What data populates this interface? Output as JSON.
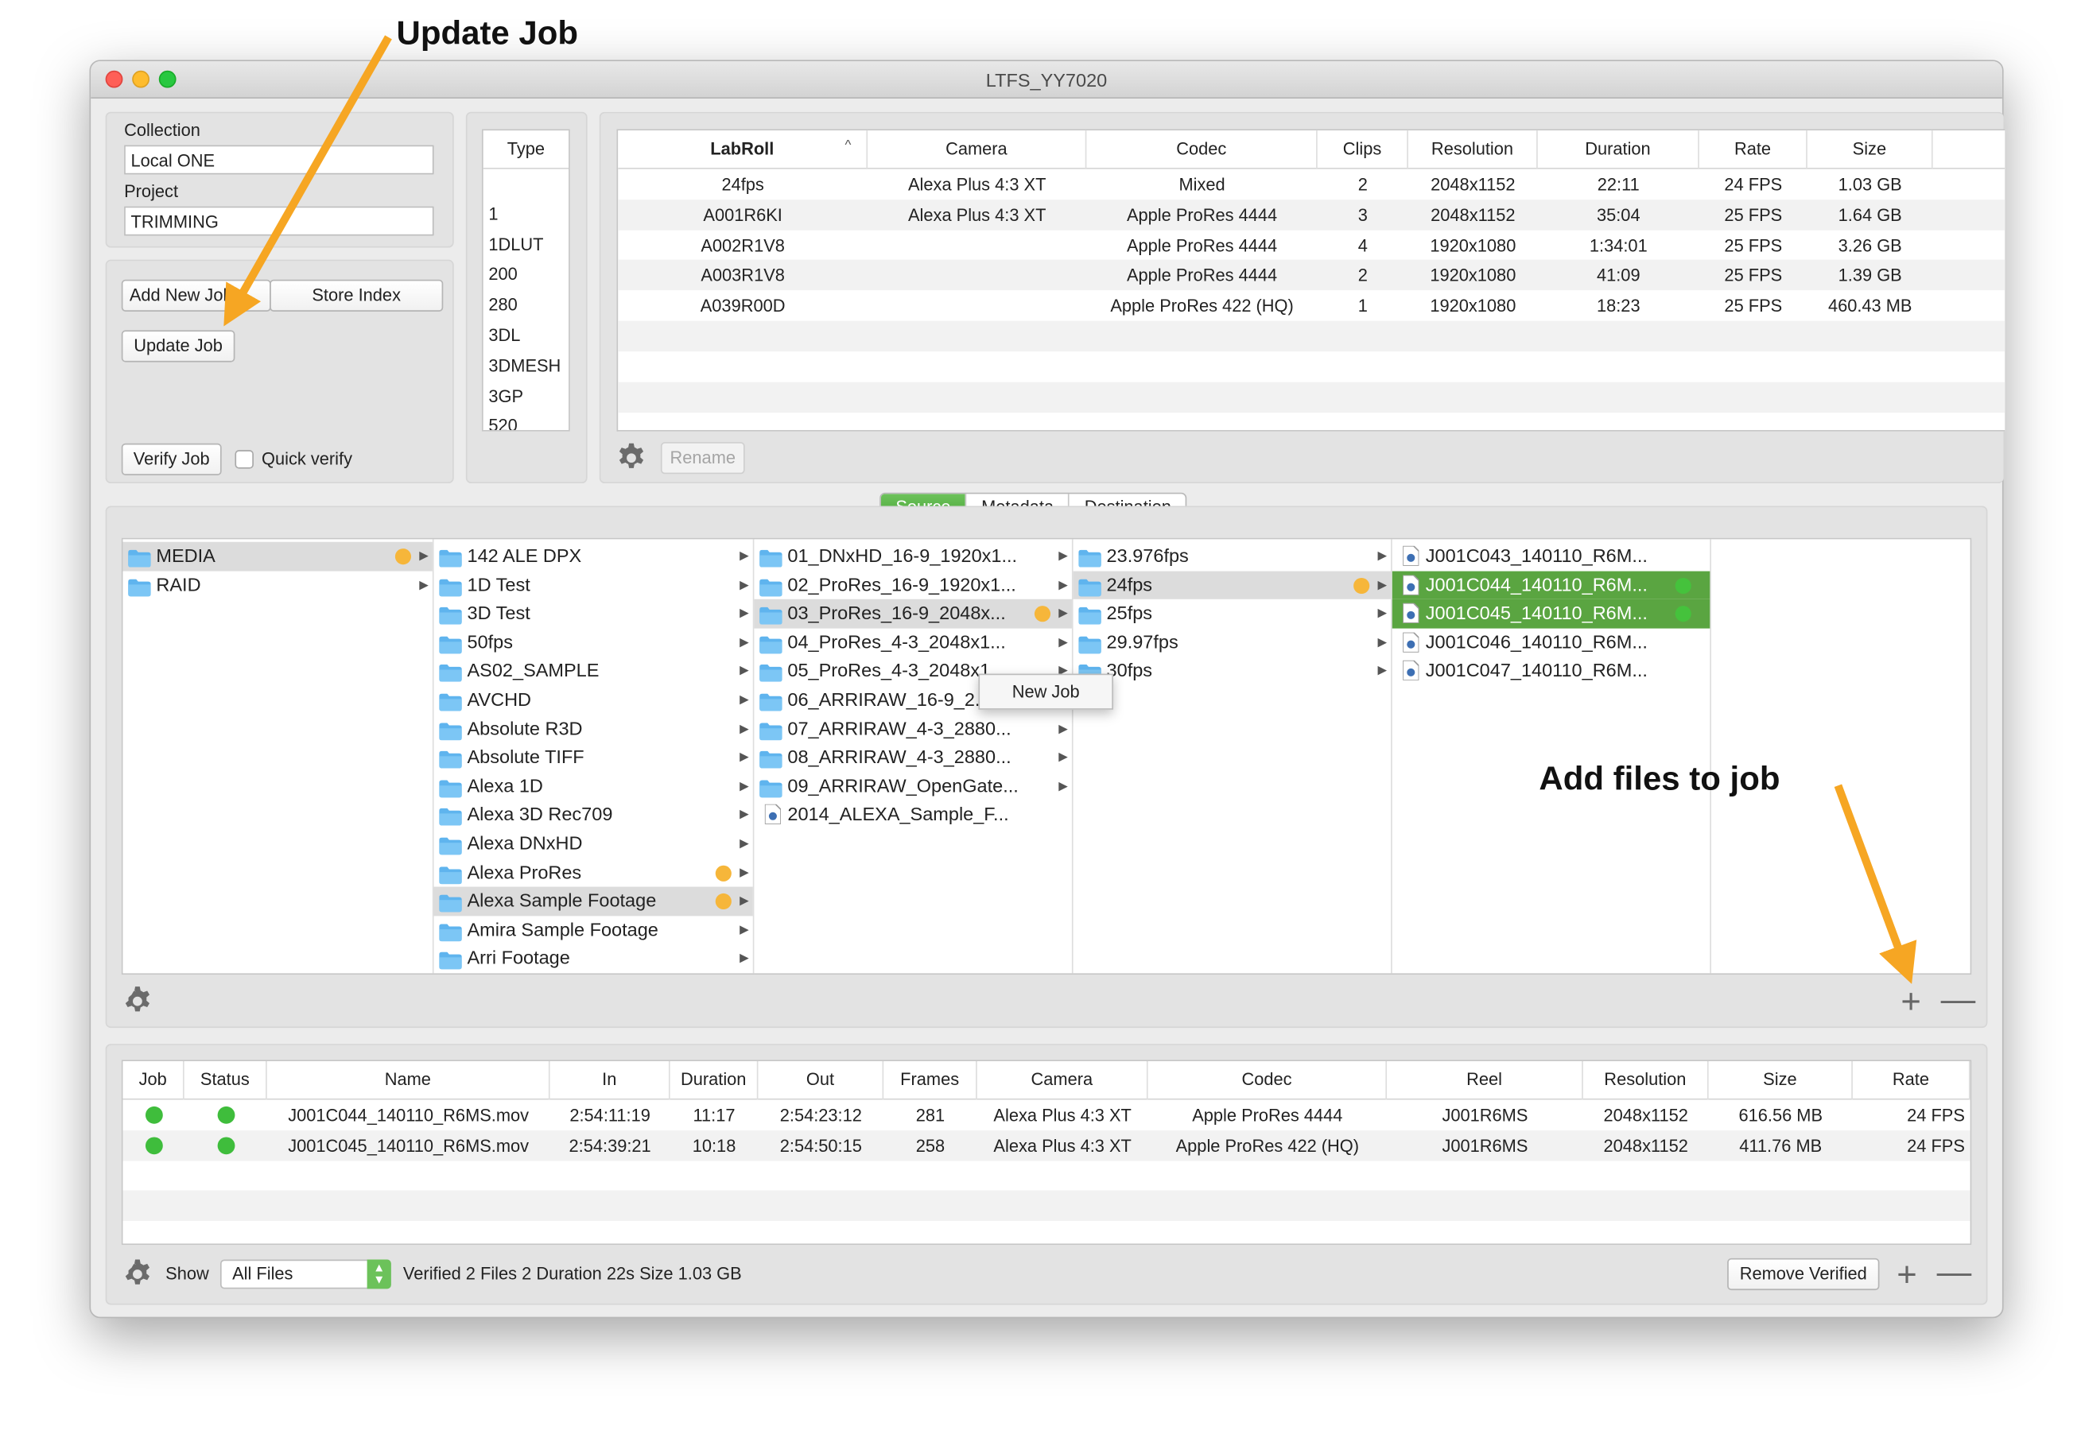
{
  "window": {
    "title": "LTFS_YY7020"
  },
  "left_panel": {
    "collection_label": "Collection",
    "collection_value": "Local ONE",
    "project_label": "Project",
    "project_value": "TRIMMING",
    "add_new_job": "Add New Job",
    "store_index": "Store Index",
    "update_job": "Update Job",
    "verify_job": "Verify Job",
    "quick_verify": "Quick verify"
  },
  "type_list": {
    "header": "Type",
    "items": [
      "",
      "1",
      "1DLUT",
      "200",
      "280",
      "3DL",
      "3DMESH",
      "3GP",
      "520"
    ]
  },
  "labroll_table": {
    "columns": [
      "LabRoll",
      "Camera",
      "Codec",
      "Clips",
      "Resolution",
      "Duration",
      "Rate",
      "Size"
    ],
    "sort_indicator": "^",
    "rows": [
      [
        "24fps",
        "Alexa Plus 4:3 XT",
        "Mixed",
        "2",
        "2048x1152",
        "22:11",
        "24 FPS",
        "1.03 GB"
      ],
      [
        "A001R6KI",
        "Alexa Plus 4:3 XT",
        "Apple ProRes 4444",
        "3",
        "2048x1152",
        "35:04",
        "25 FPS",
        "1.64 GB"
      ],
      [
        "A002R1V8",
        "",
        "Apple ProRes 4444",
        "4",
        "1920x1080",
        "1:34:01",
        "25 FPS",
        "3.26 GB"
      ],
      [
        "A003R1V8",
        "",
        "Apple ProRes 4444",
        "2",
        "1920x1080",
        "41:09",
        "25 FPS",
        "1.39 GB"
      ],
      [
        "A039R00D",
        "",
        "Apple ProRes 422 (HQ)",
        "1",
        "1920x1080",
        "18:23",
        "25 FPS",
        "460.43 MB"
      ]
    ],
    "rename": "Rename"
  },
  "tabs": [
    "Source",
    "Metadata",
    "Destination"
  ],
  "browser": {
    "col1": [
      {
        "name": "MEDIA",
        "dot": "orange",
        "arrow": true,
        "sel": true
      },
      {
        "name": "RAID",
        "arrow": true
      }
    ],
    "col2": [
      {
        "name": "142 ALE DPX",
        "arrow": true
      },
      {
        "name": "1D Test",
        "arrow": true
      },
      {
        "name": "3D Test",
        "arrow": true
      },
      {
        "name": "50fps",
        "arrow": true
      },
      {
        "name": "AS02_SAMPLE",
        "arrow": true
      },
      {
        "name": "AVCHD",
        "arrow": true
      },
      {
        "name": "Absolute R3D",
        "arrow": true
      },
      {
        "name": "Absolute TIFF",
        "arrow": true
      },
      {
        "name": "Alexa 1D",
        "arrow": true
      },
      {
        "name": "Alexa 3D Rec709",
        "arrow": true
      },
      {
        "name": "Alexa DNxHD",
        "arrow": true
      },
      {
        "name": "Alexa ProRes",
        "dot": "orange",
        "arrow": true
      },
      {
        "name": "Alexa Sample Footage",
        "dot": "orange",
        "arrow": true,
        "sel": true
      },
      {
        "name": "Amira Sample Footage",
        "arrow": true
      },
      {
        "name": "Arri Footage",
        "arrow": true
      }
    ],
    "col3": [
      {
        "name": "01_DNxHD_16-9_1920x1...",
        "arrow": true
      },
      {
        "name": "02_ProRes_16-9_1920x1...",
        "arrow": true
      },
      {
        "name": "03_ProRes_16-9_2048x...",
        "dot": "orange",
        "arrow": true,
        "sel": true
      },
      {
        "name": "04_ProRes_4-3_2048x1...",
        "arrow": true
      },
      {
        "name": "05_ProRes_4-3_2048x1...",
        "arrow": true
      },
      {
        "name": "06_ARRIRAW_16-9_2...",
        "arrow": true
      },
      {
        "name": "07_ARRIRAW_4-3_2880...",
        "arrow": true
      },
      {
        "name": "08_ARRIRAW_4-3_2880...",
        "arrow": true
      },
      {
        "name": "09_ARRIRAW_OpenGate...",
        "arrow": true
      },
      {
        "name": "2014_ALEXA_Sample_F...",
        "file": true
      }
    ],
    "col4": [
      {
        "name": "23.976fps",
        "arrow": true
      },
      {
        "name": "24fps",
        "dot": "orange",
        "arrow": true,
        "sel": true
      },
      {
        "name": "25fps",
        "arrow": true
      },
      {
        "name": "29.97fps",
        "arrow": true
      },
      {
        "name": "30fps",
        "arrow": true
      }
    ],
    "col5": [
      {
        "name": "J001C043_140110_R6M...",
        "file": true
      },
      {
        "name": "J001C044_140110_R6M...",
        "file": true,
        "dot": "green",
        "hl": true
      },
      {
        "name": "J001C045_140110_R6M...",
        "file": true,
        "dot": "green",
        "hl": true
      },
      {
        "name": "J001C046_140110_R6M...",
        "file": true
      },
      {
        "name": "J001C047_140110_R6M...",
        "file": true
      }
    ],
    "context_menu": "New Job"
  },
  "jobs_table": {
    "columns": [
      "Job",
      "Status",
      "Name",
      "In",
      "Duration",
      "Out",
      "Frames",
      "Camera",
      "Codec",
      "Reel",
      "Resolution",
      "Size",
      "Rate"
    ],
    "rows": [
      [
        "",
        "",
        "J001C044_140110_R6MS.mov",
        "2:54:11:19",
        "11:17",
        "2:54:23:12",
        "281",
        "Alexa Plus 4:3 XT",
        "Apple ProRes 4444",
        "J001R6MS",
        "2048x1152",
        "616.56 MB",
        "24 FPS"
      ],
      [
        "",
        "",
        "J001C045_140110_R6MS.mov",
        "2:54:39:21",
        "10:18",
        "2:54:50:15",
        "258",
        "Alexa Plus 4:3 XT",
        "Apple ProRes 422 (HQ)",
        "J001R6MS",
        "2048x1152",
        "411.76 MB",
        "24 FPS"
      ]
    ]
  },
  "footer": {
    "show_label": "Show",
    "filter_value": "All Files",
    "status_text": "Verified 2 Files 2 Duration 22s Size 1.03 GB",
    "remove_verified": "Remove Verified"
  },
  "annotations": {
    "update_job": "Update Job",
    "add_files": "Add files to job"
  },
  "colors": {
    "accent_green": "#5aa541",
    "status_orange": "#f6b63a",
    "status_green": "#45c23c",
    "arrow_orange": "#f6a623"
  }
}
